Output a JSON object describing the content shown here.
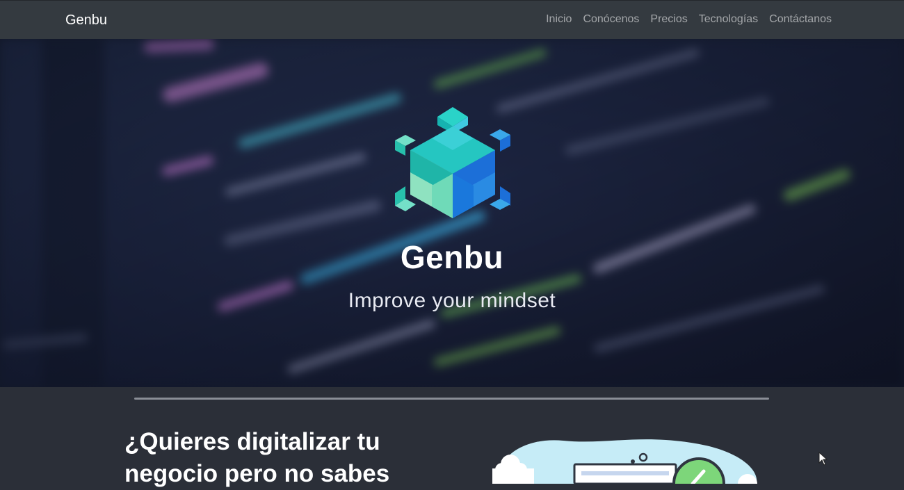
{
  "navbar": {
    "brand": "Genbu",
    "links": [
      {
        "label": "Inicio"
      },
      {
        "label": "Conócenos"
      },
      {
        "label": "Precios"
      },
      {
        "label": "Tecnologías"
      },
      {
        "label": "Contáctanos"
      }
    ]
  },
  "hero": {
    "logo_icon": "genbu-hexagon-logo",
    "title": "Genbu",
    "subtitle": "Improve your mindset"
  },
  "section": {
    "heading": "¿Quieres digitalizar tu negocio pero no sabes"
  },
  "colors": {
    "navbar_bg": "#343a40",
    "page_bg": "#2b2f38",
    "hero_bg": "#1a2236",
    "logo_teal": "#1fb5b5",
    "logo_blue": "#1c6fd8"
  }
}
